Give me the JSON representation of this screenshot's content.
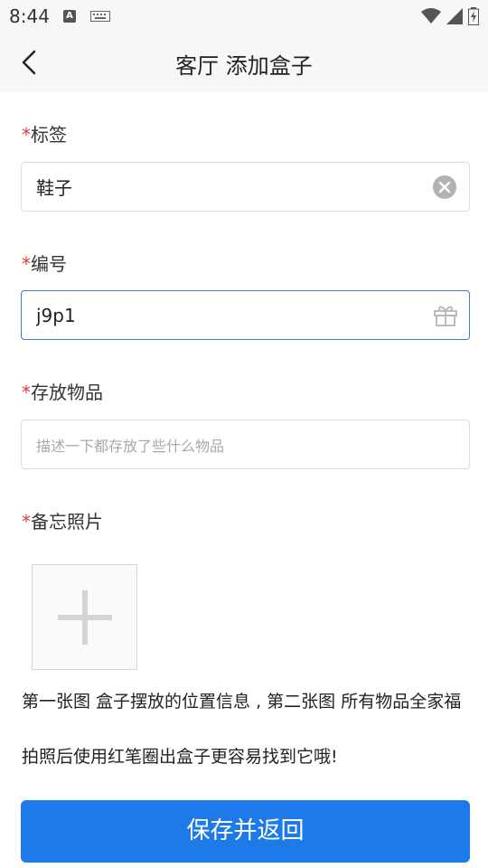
{
  "status_bar": {
    "time": "8:44",
    "a_icon_label": "A"
  },
  "header": {
    "title": "客厅  添加盒子"
  },
  "form": {
    "required_mark": "*",
    "label_field": {
      "label": "标签",
      "value": "鞋子"
    },
    "number_field": {
      "label": "编号",
      "value": "j9p1"
    },
    "items_field": {
      "label": "存放物品",
      "placeholder": "描述一下都存放了些什么物品"
    },
    "photos_field": {
      "label": "备忘照片"
    }
  },
  "hint": {
    "line1": "第一张图 盒子摆放的位置信息 , 第二张图 所有物品全家福",
    "line2": "拍照后使用红笔圈出盒子更容易找到它哦!"
  },
  "actions": {
    "save_label": "保存并返回"
  },
  "colors": {
    "primary": "#1e7ae8",
    "required": "#e53935",
    "focus_border": "#3a7bd5"
  }
}
